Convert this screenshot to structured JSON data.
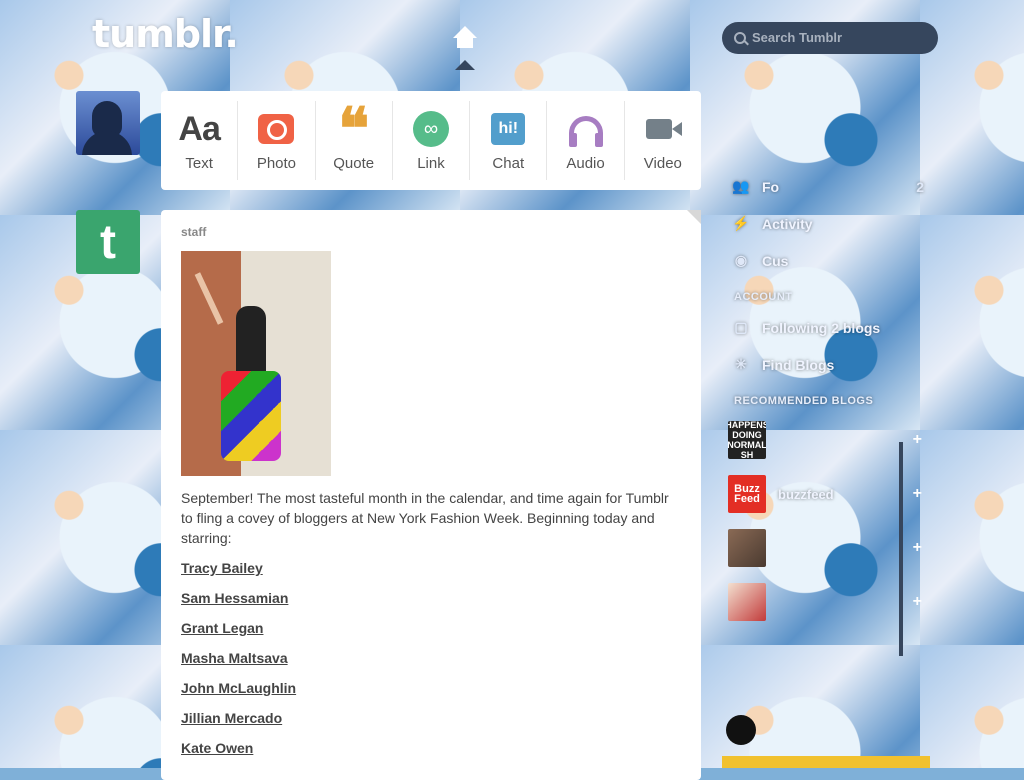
{
  "header": {
    "logo": "tumblr.",
    "search_placeholder": "Search Tumblr"
  },
  "post_types": [
    {
      "label": "Text",
      "icon": "text-icon"
    },
    {
      "label": "Photo",
      "icon": "photo-icon"
    },
    {
      "label": "Quote",
      "icon": "quote-icon"
    },
    {
      "label": "Link",
      "icon": "link-icon"
    },
    {
      "label": "Chat",
      "icon": "chat-icon"
    },
    {
      "label": "Audio",
      "icon": "audio-icon"
    },
    {
      "label": "Video",
      "icon": "video-icon"
    }
  ],
  "icons": {
    "text_glyph": "Aa",
    "quote_glyph": "❝",
    "link_glyph": "∞",
    "chat_glyph": "hi!",
    "staff_avatar_glyph": "t"
  },
  "post": {
    "author": "staff",
    "body": "September! The most tasteful month in the calendar, and time again for Tumblr to fling a covey of bloggers at New York Fashion Week. Beginning today and starring:",
    "links": [
      "Tracy Bailey",
      "Sam Hessamian",
      "Grant Legan",
      "Masha Maltsava",
      "John McLaughlin",
      "Jillian Mercado",
      "Kate Owen"
    ]
  },
  "sidebar": {
    "items": [
      {
        "label": "Fo",
        "icon": "followers-icon",
        "count": "2"
      },
      {
        "label": "Activity",
        "icon": "activity-icon",
        "count": ""
      },
      {
        "label": "Cus",
        "icon": "eye-icon",
        "count": ""
      }
    ],
    "account_heading": "ACCOUNT",
    "account_items": [
      {
        "label": "Following 2 blogs",
        "icon": "following-icon"
      },
      {
        "label": "Find Blogs",
        "icon": "find-blogs-icon"
      }
    ],
    "recommended_heading": "RECOMMENDED BLOGS",
    "recommended": [
      {
        "name": "",
        "thumb_text": "HAPPENS DOING NORMAL SH",
        "color": "#222222"
      },
      {
        "name": "buzzfeed",
        "thumb_text": "Buzz Feed",
        "color": "#e32e24"
      },
      {
        "name": "",
        "thumb_text": "",
        "color": "#7a5a4a"
      },
      {
        "name": "",
        "thumb_text": "",
        "color": "#c23b3b"
      }
    ]
  },
  "colors": {
    "tumblr_blue": "#36465d",
    "staff_green": "#3aa56e",
    "photo": "#f06245",
    "quote": "#e6a33a",
    "link": "#56bc8a",
    "chat": "#529ecc",
    "audio": "#a77dc2",
    "video": "#748089"
  }
}
